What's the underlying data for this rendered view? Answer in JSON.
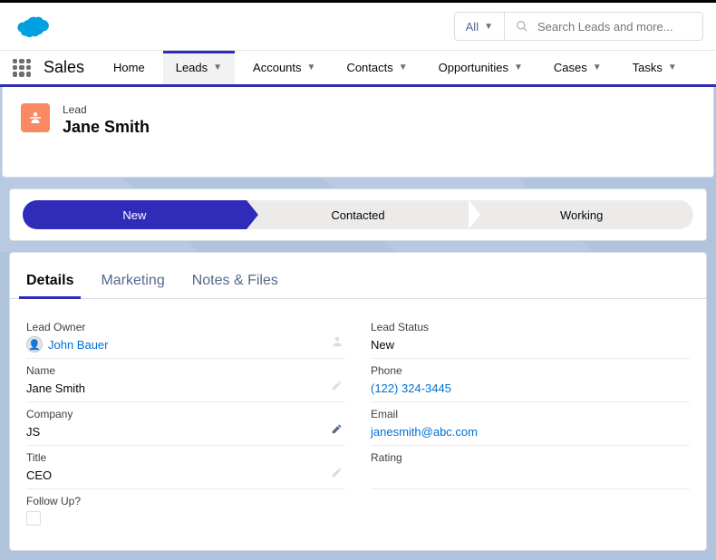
{
  "search": {
    "scope": "All",
    "placeholder": "Search Leads and more..."
  },
  "app": {
    "name": "Sales"
  },
  "nav": {
    "home": "Home",
    "leads": "Leads",
    "accounts": "Accounts",
    "contacts": "Contacts",
    "opportunities": "Opportunities",
    "cases": "Cases",
    "tasks": "Tasks"
  },
  "record": {
    "object_label": "Lead",
    "name": "Jane Smith"
  },
  "path": {
    "new": "New",
    "contacted": "Contacted",
    "working": "Working"
  },
  "tabs": {
    "details": "Details",
    "marketing": "Marketing",
    "notes": "Notes & Files"
  },
  "fields": {
    "lead_owner": {
      "label": "Lead Owner",
      "value": "John Bauer"
    },
    "name": {
      "label": "Name",
      "value": "Jane Smith"
    },
    "company": {
      "label": "Company",
      "value": "JS"
    },
    "title": {
      "label": "Title",
      "value": "CEO"
    },
    "follow_up": {
      "label": "Follow Up?"
    },
    "lead_status": {
      "label": "Lead Status",
      "value": "New"
    },
    "phone": {
      "label": "Phone",
      "value": "(122) 324-3445"
    },
    "email": {
      "label": "Email",
      "value": "janesmith@abc.com"
    },
    "rating": {
      "label": "Rating",
      "value": ""
    }
  }
}
